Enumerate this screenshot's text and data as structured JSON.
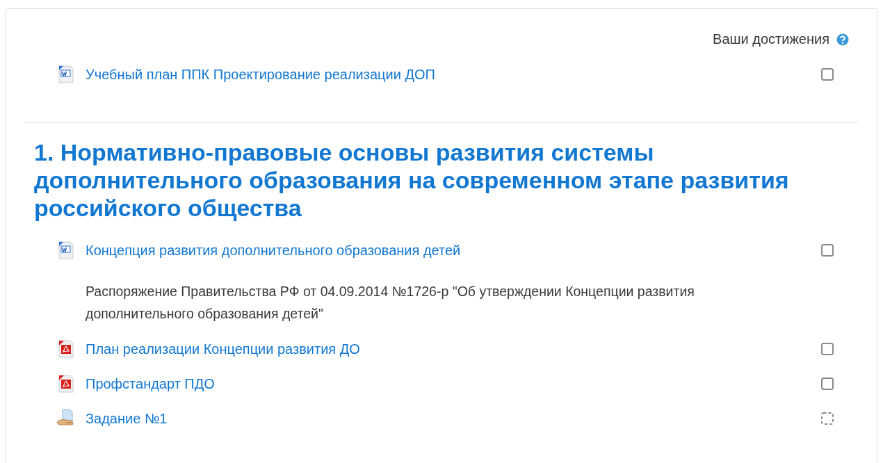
{
  "progress_header": {
    "label": "Ваши достижения"
  },
  "intro_items": [
    {
      "kind": "word",
      "title": "Учебный план ППК Проектирование реализации ДОП",
      "auto_completion": false,
      "checked": false
    }
  ],
  "sections": [
    {
      "title": "1. Нормативно-правовые основы развития системы дополнительного образования на современном этапе развития российского общества",
      "items": [
        {
          "kind": "word",
          "title": "Концепция развития дополнительного образования детей",
          "auto_completion": false,
          "checked": false
        },
        {
          "kind": "label",
          "text": "Распоряжение Правительства РФ от 04.09.2014 №1726-р \"Об утверждении Концепции развития дополнительного образования детей\""
        },
        {
          "kind": "pdf",
          "title": "План реализации Концепции развития ДО",
          "auto_completion": false,
          "checked": false
        },
        {
          "kind": "pdf",
          "title": "Профстандарт ПДО",
          "auto_completion": false,
          "checked": false
        },
        {
          "kind": "assign",
          "title": "Задание №1",
          "auto_completion": true,
          "checked": false
        }
      ]
    }
  ]
}
